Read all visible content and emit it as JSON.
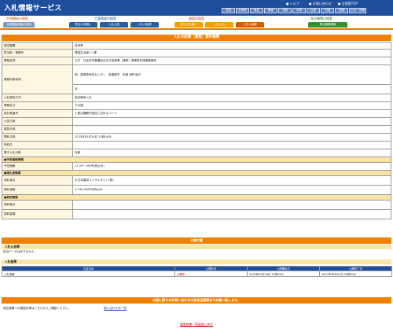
{
  "header": {
    "title": "入札情報サービス",
    "links": [
      "ヘルプ",
      "お問い合わせ",
      "全国版TOP"
    ],
    "regions": [
      "全国",
      "北海道",
      "東北",
      "関東",
      "北陸",
      "中部",
      "近畿",
      "中国",
      "四国",
      "九州・沖縄"
    ]
  },
  "nav": {
    "groups": [
      "工事情報の検索",
      "業務の検索",
      "発注機関の検索"
    ],
    "left_label": "手続開始の検索",
    "left_button": "手続開始情報の検索",
    "buttons": [
      "発注の見通し",
      "入札公告",
      "入札の結果",
      "発注の見通し",
      "入札公告",
      "入札の結果",
      "発注機関情報"
    ]
  },
  "panel": {
    "title": "入札の結果（業務）案件概要",
    "rows": [
      {
        "k": "発注機関",
        "v": "岐阜県"
      },
      {
        "k": "担当部・事務所",
        "v": "環境生活部○○課"
      },
      {
        "k": "業務名称",
        "v": "公共　社会資本整備総合交付金事業（通常）事業再評価業務委託"
      },
      {
        "k": "業務対象地域",
        "v": "他：各務原浄化センター　各務原市　前渡 西町地内"
      },
      {
        "k": "",
        "v": "京："
      },
      {
        "k": "入札契約方式",
        "v": "指名競争入札"
      },
      {
        "k": "業務区分",
        "v": "下水道"
      },
      {
        "k": "設計書番号",
        "v": "＊発注機関が独自に定めるコード"
      },
      {
        "k": "公告日時",
        "v": ""
      },
      {
        "k": "縦覧日時",
        "v": ""
      },
      {
        "k": "開札日時",
        "v": "2023年05月16日 10時00分"
      },
      {
        "k": "特約日",
        "v": ""
      },
      {
        "k": "電子入札対象",
        "v": "対象"
      }
    ],
    "section_yotei": "予定価格情報",
    "yotei_row": {
      "k": "予定価格",
      "v": "11,507,100円(税込み)"
    },
    "section_rakusatsu": "落札者情報",
    "rakusatsu_rows": [
      {
        "k": "落札者名",
        "v": "中日本建設コンサルタント(株)"
      },
      {
        "k": "落札価格",
        "v": "9,130,350円(税込み)"
      }
    ],
    "section_keiyaku": "契約情報",
    "keiyaku_rows": [
      {
        "k": "契約者名",
        "v": ""
      },
      {
        "k": "契約金額",
        "v": ""
      }
    ]
  },
  "docs": {
    "title": "公開文書",
    "notice_section": "入札公告等",
    "notice_empty": "該当データはありません",
    "result_section": "入札結果",
    "columns": [
      "文書名称",
      "公開状況",
      "公開開始日",
      "公開終了日"
    ],
    "rows": [
      {
        "name": "入札情報",
        "status": "公開中",
        "start": "2023年05月16日 12時29分",
        "end": "2027年06月01日 00時00分"
      }
    ]
  },
  "contact": {
    "bar": "内容に関するお問い合わせは各発注機関までお願い致します。",
    "text": "発注機関への連絡先等はこちらからご確認ください。",
    "link": "問い合わせ先一覧"
  },
  "footer": {
    "back_link": "検索結果一覧画面に戻る"
  },
  "colors": {
    "header_blue": "#1f4e9c",
    "accent_orange": "#f08000",
    "section_beige": "#fbe4a8",
    "key_cell": "#fff6df"
  }
}
